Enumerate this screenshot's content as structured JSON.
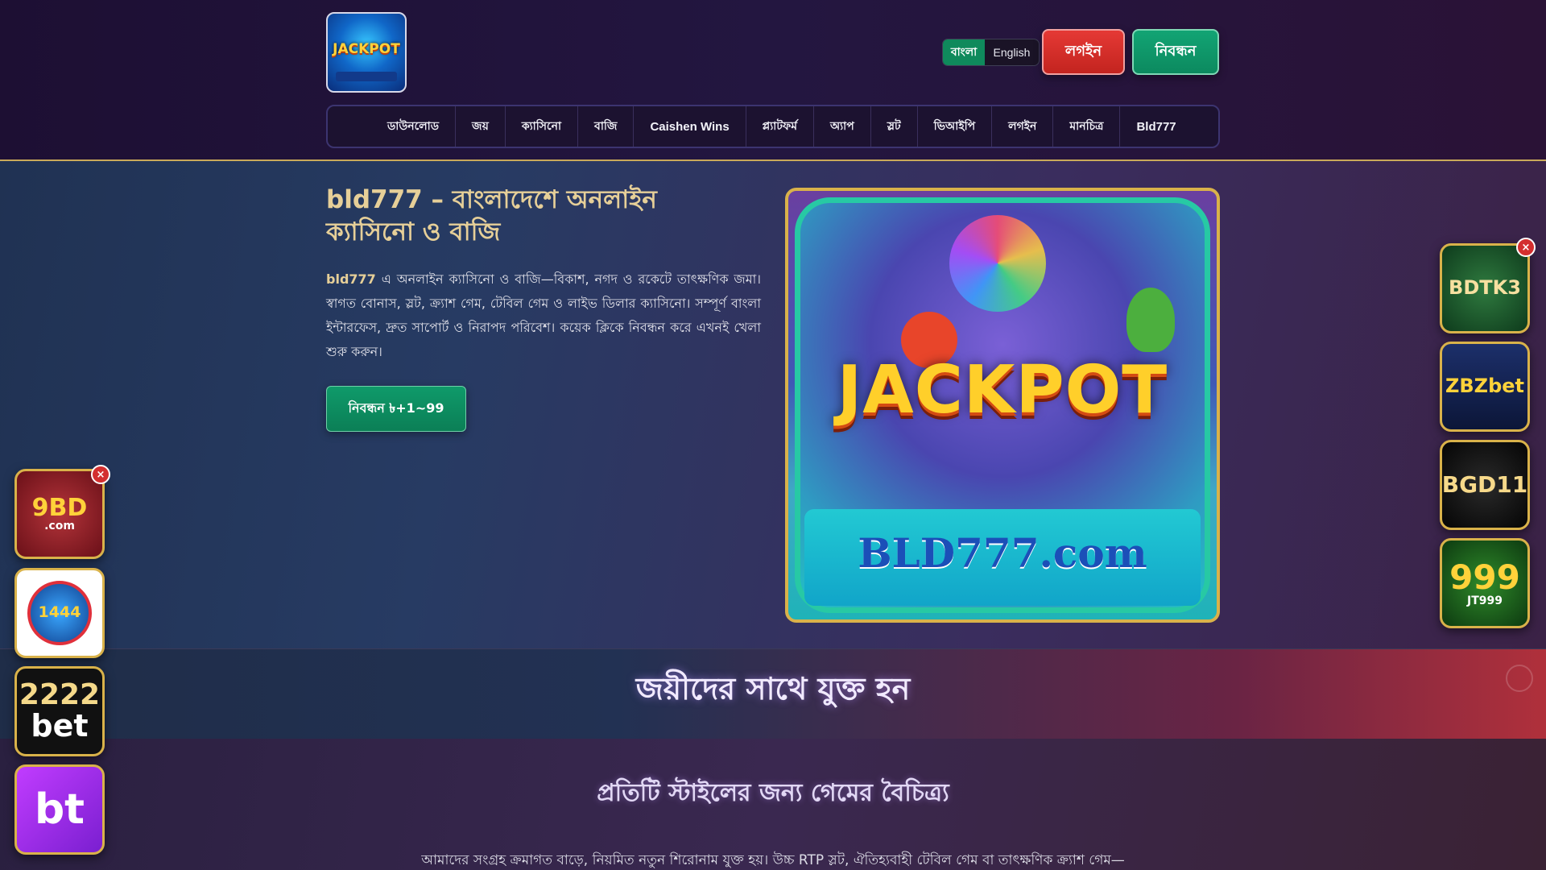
{
  "header": {
    "logo_text": "JACKPOT",
    "language": {
      "bn_label": "বাংলা",
      "en_label": "English"
    },
    "login_label": "লগইন",
    "register_label": "নিবন্ধন"
  },
  "nav": {
    "items": [
      {
        "label": "ডাউনলোড"
      },
      {
        "label": "জয়"
      },
      {
        "label": "ক্যাসিনো"
      },
      {
        "label": "বাজি"
      },
      {
        "label": "Caishen Wins"
      },
      {
        "label": "প্ল্যাটফর্ম"
      },
      {
        "label": "অ্যাপ"
      },
      {
        "label": "স্লট"
      },
      {
        "label": "ভিআইপি"
      },
      {
        "label": "লগইন"
      },
      {
        "label": "মানচিত্র"
      },
      {
        "label": "Bld777"
      }
    ]
  },
  "hero": {
    "title": "bld777 – বাংলাদেশে অনলাইন ক্যাসিনো ও বাজি",
    "brand": "bld777",
    "description": " এ অনলাইন ক্যাসিনো ও বাজি—বিকাশ, নগদ ও রকেটে তাৎক্ষণিক জমা। স্বাগত বোনাস, স্লট, ক্র্যাশ গেম, টেবিল গেম ও লাইভ ডিলার ক্যাসিনো। সম্পূর্ণ বাংলা ইন্টারফেস, দ্রুত সাপোর্ট ও নিরাপদ পরিবেশ। কয়েক ক্লিকে নিবন্ধন করে এখনই খেলা শুরু করুন।",
    "cta_label": "নিবন্ধন ৳+1~99",
    "image": {
      "jackpot_text": "JACKPOT",
      "site_text": "BLD777.com"
    }
  },
  "band": {
    "title": "জয়ীদের সাথে যুক্ত হন"
  },
  "games_section": {
    "title": "প্রতিটি স্টাইলের জন্য গেমের বৈচিত্র্য",
    "description": "আমাদের সংগ্রহ ক্রমাগত বাড়ে, নিয়মিত নতুন শিরোনাম যুক্ত হয়। উচ্চ RTP স্লট, ঐতিহ্যবাহী টেবিল গেম বা তাৎক্ষণিক ক্র্যাশ গেম—"
  },
  "left_promos": {
    "close_label": "×",
    "items": [
      {
        "main": "9BD",
        "sub": ".com"
      },
      {
        "main": "1444"
      },
      {
        "main": "2222",
        "sub": "bet"
      },
      {
        "main": "bt"
      }
    ]
  },
  "right_promos": {
    "close_label": "×",
    "items": [
      {
        "main": "BDTK3"
      },
      {
        "main": "ZBZbet"
      },
      {
        "main": "BGD11"
      },
      {
        "main": "999",
        "sub": "JT999"
      }
    ]
  },
  "colors": {
    "accent_gold": "#d9b24a",
    "login_red": "#e53935",
    "register_green": "#0f9a6a"
  }
}
